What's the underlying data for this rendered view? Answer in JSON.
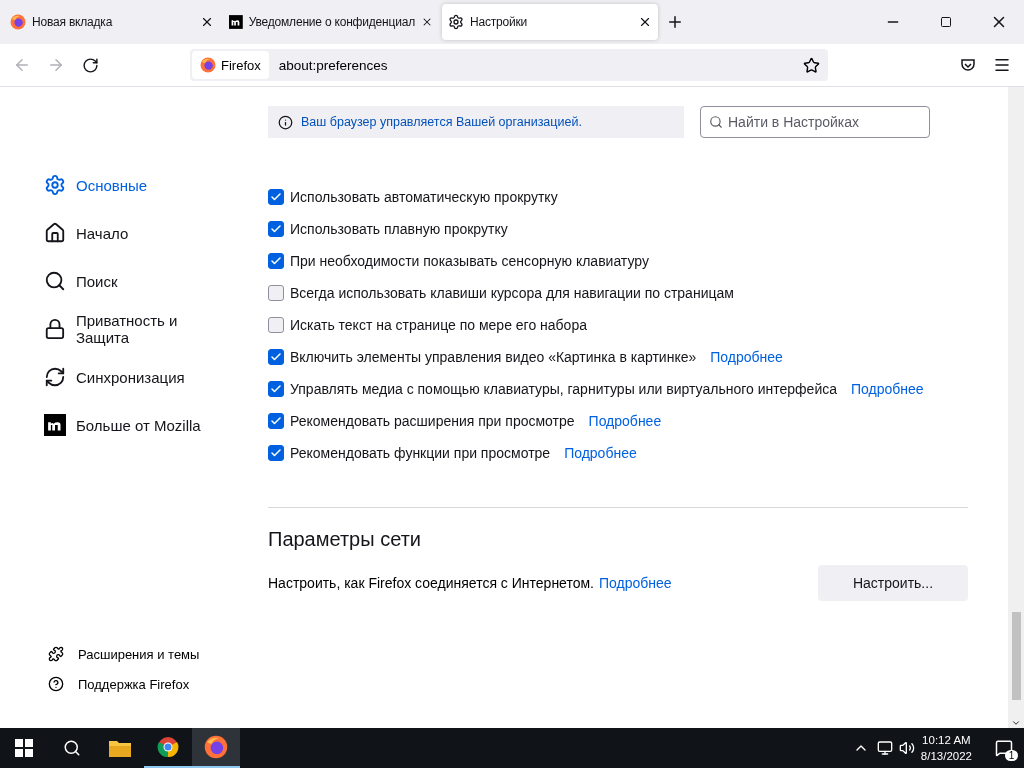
{
  "tabs": [
    {
      "label": "Новая вкладка",
      "kind": "firefox",
      "selected": false
    },
    {
      "label": "Уведомление о конфиденциал",
      "kind": "mozilla",
      "selected": false
    },
    {
      "label": "Настройки",
      "kind": "gear",
      "selected": true
    }
  ],
  "address_bar": {
    "identity": "Firefox",
    "url": "about:preferences"
  },
  "notice": "Ваш браузер управляется Вашей организацией.",
  "search": {
    "placeholder": "Найти в Настройках"
  },
  "sidebar": {
    "items": [
      {
        "label": "Основные",
        "kind": "gear",
        "selected": true
      },
      {
        "label": "Начало",
        "kind": "home",
        "selected": false
      },
      {
        "label": "Поиск",
        "kind": "search",
        "selected": false
      },
      {
        "label": "Приватность и Защита",
        "kind": "lock",
        "selected": false
      },
      {
        "label": "Синхронизация",
        "kind": "sync",
        "selected": false
      },
      {
        "label": "Больше от Mozilla",
        "kind": "mozilla",
        "selected": false
      }
    ],
    "footer": [
      {
        "label": "Расширения и темы",
        "kind": "puzzle"
      },
      {
        "label": "Поддержка Firefox",
        "kind": "help"
      }
    ]
  },
  "options": [
    {
      "label": "Использовать автоматическую прокрутку",
      "checked": true
    },
    {
      "label": "Использовать плавную прокрутку",
      "checked": true
    },
    {
      "label": "При необходимости показывать сенсорную клавиатуру",
      "checked": true
    },
    {
      "label": "Всегда использовать клавиши курсора для навигации по страницам",
      "checked": false
    },
    {
      "label": "Искать текст на странице по мере его набора",
      "checked": false
    },
    {
      "label": "Включить элементы управления видео «Картинка в картинке»",
      "checked": true,
      "link": "Подробнее"
    },
    {
      "label": "Управлять медиа с помощью клавиатуры, гарнитуры или виртуального интерфейса",
      "checked": true,
      "link": "Подробнее"
    },
    {
      "label": "Рекомендовать расширения при просмотре",
      "checked": true,
      "link": "Подробнее"
    },
    {
      "label": "Рекомендовать функции при просмотре",
      "checked": true,
      "link": "Подробнее"
    }
  ],
  "network": {
    "title": "Параметры сети",
    "text": "Настроить, как Firefox соединяется с Интернетом.",
    "link": "Подробнее",
    "button": "Настроить..."
  },
  "taskbar": {
    "time": "10:12 AM",
    "date": "8/13/2022",
    "notifications": "1"
  }
}
